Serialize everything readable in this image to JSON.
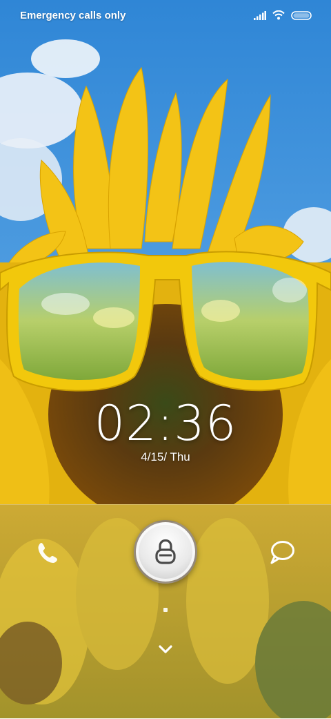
{
  "status_bar": {
    "carrier_text": "Emergency calls only",
    "icons": [
      "signal-icon",
      "wifi-icon",
      "battery-icon"
    ]
  },
  "lockscreen": {
    "time": "02:36",
    "date": "4/15/  Thu"
  },
  "actions": {
    "left_icon": "phone-icon",
    "center_icon": "lock-icon",
    "right_icon": "message-icon",
    "bottom_icon": "chevron-down-icon"
  },
  "colors": {
    "sky": "#3a8fd9",
    "petal": "#f5c515",
    "glasses": "#f2c80c",
    "seed": "#5a3a10"
  }
}
